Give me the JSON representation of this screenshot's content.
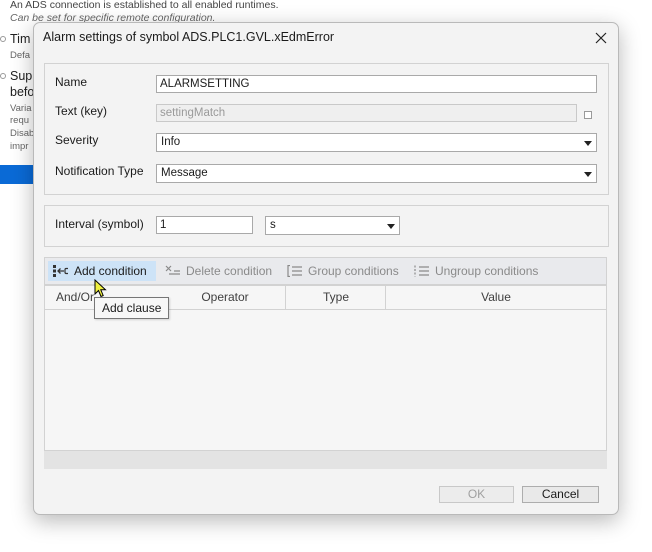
{
  "background": {
    "line1": "An ADS connection is established to all enabled runtimes.",
    "line2": "Can be set for specific remote configuration.",
    "side1": "Tim",
    "side2": "Defa",
    "side3": "Supp",
    "side4": "befo",
    "side5": "Varia",
    "side6": "requ",
    "side7": "Disab",
    "side8": "impr"
  },
  "dialog": {
    "title": "Alarm settings of symbol ADS.PLC1.GVL.xEdmError",
    "fields": {
      "name_label": "Name",
      "name_value": "ALARMSETTING",
      "text_label": "Text (key)",
      "text_value": "settingMatch",
      "severity_label": "Severity",
      "severity_value": "Info",
      "notification_label": "Notification Type",
      "notification_value": "Message"
    },
    "interval": {
      "label": "Interval (symbol)",
      "value": "1",
      "unit": "s"
    },
    "toolbar": {
      "add": "Add condition",
      "delete": "Delete condition",
      "group": "Group conditions",
      "ungroup": "Ungroup conditions"
    },
    "grid": {
      "columns": [
        "And/Or",
        "Operator",
        "Type",
        "Value"
      ]
    },
    "tooltip": "Add clause",
    "buttons": {
      "ok": "OK",
      "cancel": "Cancel"
    }
  },
  "icons": {
    "close": "close-icon",
    "add": "add-condition-icon",
    "delete": "delete-condition-icon",
    "group": "group-conditions-icon",
    "ungroup": "ungroup-conditions-icon",
    "cursor": "mouse-cursor-icon"
  },
  "colors": {
    "accent": "#0a6ad6",
    "active_button": "#cde3f7",
    "dialog_bg": "#f3f3f3"
  }
}
